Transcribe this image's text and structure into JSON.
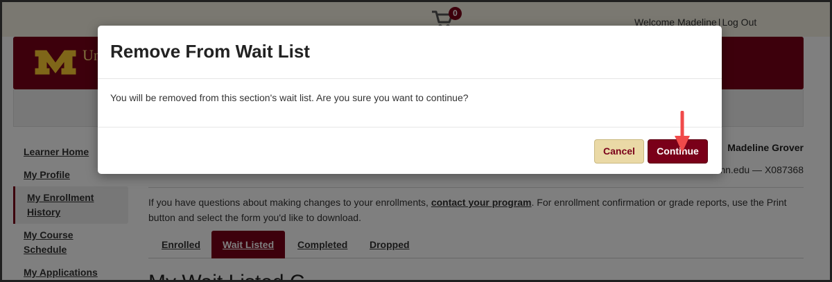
{
  "header": {
    "cart_count": "0",
    "welcome_text": "Welcome Madeline",
    "separator": "|",
    "logout_label": "Log Out"
  },
  "brand": {
    "logo_letter": "M",
    "text": "Un"
  },
  "sidebar": {
    "items": [
      {
        "label": "Learner Home"
      },
      {
        "label": "My Profile"
      },
      {
        "label": "My Enrollment History"
      },
      {
        "label": "My Course Schedule"
      },
      {
        "label": "My Applications"
      }
    ]
  },
  "user": {
    "name": "Madeline Grover",
    "info": "mn.edu — X087368"
  },
  "main": {
    "info_prefix": "If you have questions about making changes to your enrollments,",
    "info_link": "contact your program",
    "info_suffix": ". For enrollment confirmation or grade reports, use the Print button and select the form you'd like to download.",
    "tabs": [
      {
        "label": "Enrolled"
      },
      {
        "label": "Wait Listed"
      },
      {
        "label": "Completed"
      },
      {
        "label": "Dropped"
      }
    ],
    "section_title": "My Wait Listed C"
  },
  "modal": {
    "title": "Remove From Wait List",
    "body": "You will be removed from this section's wait list. Are you sure you want to continue?",
    "cancel_label": "Cancel",
    "continue_label": "Continue"
  },
  "colors": {
    "maroon": "#7a0019",
    "gold": "#ffde7a",
    "cancel_bg": "#ead9a6",
    "arrow": "#f04a4a"
  }
}
